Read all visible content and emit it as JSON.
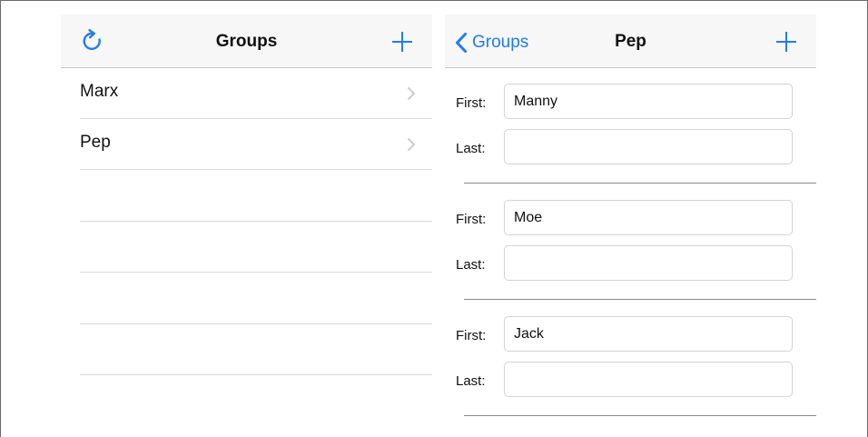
{
  "colors": {
    "accent": "#1f7cf0",
    "navbar_bg": "#f7f7f8",
    "separator": "#c8c7cc"
  },
  "groups_screen": {
    "nav": {
      "title": "Groups",
      "left_icon": "refresh-icon",
      "right_icon": "plus-icon"
    },
    "rows": [
      {
        "label": "Marx"
      },
      {
        "label": "Pep"
      }
    ]
  },
  "detail_screen": {
    "nav": {
      "back_label": "Groups",
      "title": "Pep",
      "right_icon": "plus-icon"
    },
    "first_label": "First:",
    "last_label": "Last:",
    "people": [
      {
        "first": "Manny",
        "last": ""
      },
      {
        "first": "Moe",
        "last": ""
      },
      {
        "first": "Jack",
        "last": ""
      }
    ]
  }
}
